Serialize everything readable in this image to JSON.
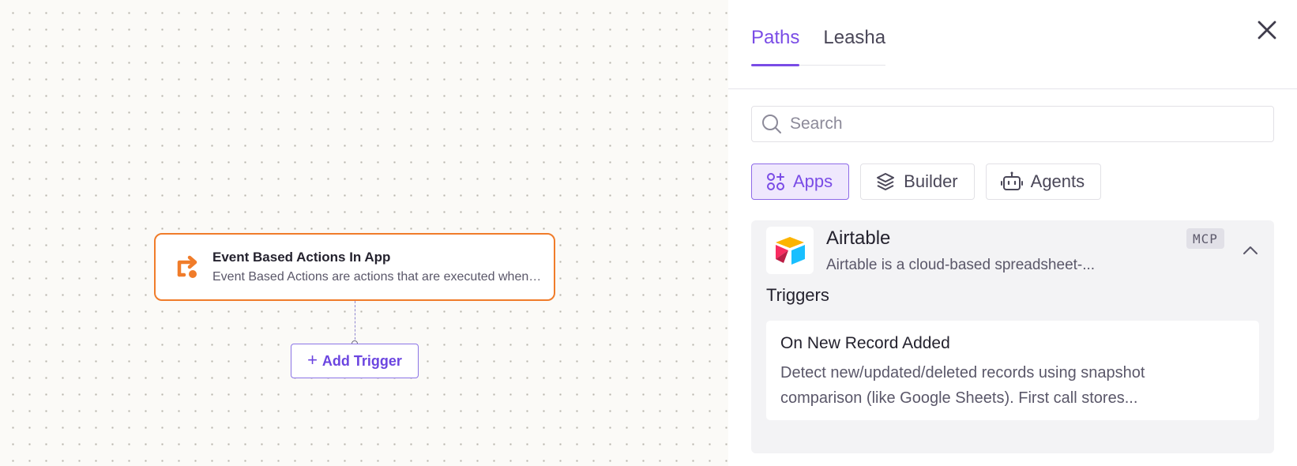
{
  "canvas": {
    "node": {
      "title": "Event Based Actions In App",
      "description": "Event Based Actions are actions that are executed when an event occurs in the app"
    },
    "add_trigger_label": "Add Trigger",
    "add_trigger_plus": "+"
  },
  "panel": {
    "tabs": [
      {
        "label": "Paths",
        "active": true
      },
      {
        "label": "Leasha",
        "active": false
      }
    ],
    "search": {
      "placeholder": "Search",
      "value": ""
    },
    "filters": [
      {
        "label": "Apps",
        "icon": "apps-grid-plus-icon",
        "active": true
      },
      {
        "label": "Builder",
        "icon": "stacked-layers-icon",
        "active": false
      },
      {
        "label": "Agents",
        "icon": "robot-icon",
        "active": false
      }
    ],
    "app": {
      "name": "Airtable",
      "description": "Airtable is a cloud-based spreadsheet-...",
      "badge": "MCP",
      "section_title": "Triggers",
      "triggers": [
        {
          "title": "On New Record Added",
          "description_line1": "Detect new/updated/deleted records using snapshot",
          "description_line2": "comparison (like Google Sheets). First call stores..."
        }
      ]
    }
  },
  "colors": {
    "accent": "#7a4ce6",
    "node_border": "#f07c2a",
    "canvas_bg": "#fbfaf7",
    "card_bg": "#f3f3f5"
  }
}
